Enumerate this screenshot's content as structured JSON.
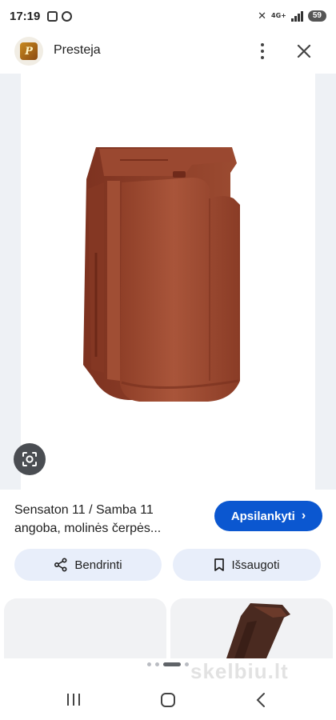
{
  "status_bar": {
    "time": "17:19",
    "network": "4G+",
    "battery": "59"
  },
  "header": {
    "site_name": "Presteja",
    "logo_letter": "P"
  },
  "product": {
    "title_line1": "Sensaton 11 / Samba 11",
    "title_line2": "angoba, molinės čerpės...",
    "tile_color": "#9e4a32"
  },
  "buttons": {
    "visit_label": "Apsilankyti",
    "share_label": "Bendrinti",
    "save_label": "Išsaugoti"
  },
  "watermark": "skelbiu.lt",
  "colors": {
    "accent": "#0b57d0",
    "action_bg": "#e8eefa"
  }
}
